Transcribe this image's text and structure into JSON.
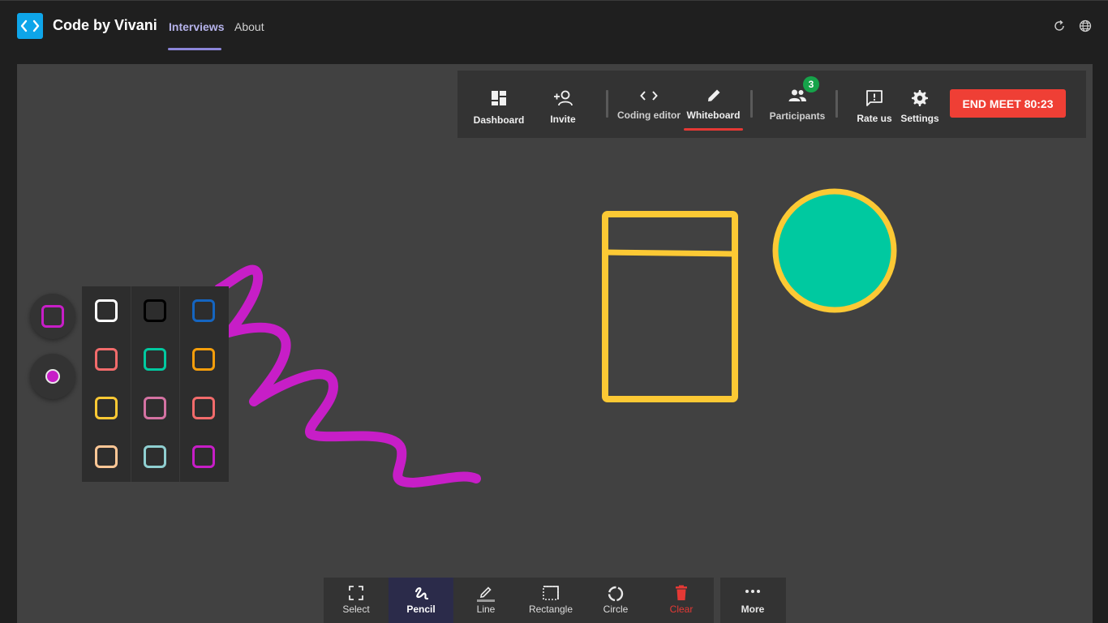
{
  "app": {
    "title": "Code by Vivani"
  },
  "nav": {
    "tabs": [
      {
        "label": "Interviews",
        "active": true
      },
      {
        "label": "About",
        "active": false
      }
    ]
  },
  "header_icons": [
    "refresh-icon",
    "globe-icon"
  ],
  "meeting_toolbar": {
    "items": [
      {
        "label": "Dashboard",
        "icon": "dashboard-icon"
      },
      {
        "label": "Invite",
        "icon": "add-person-icon"
      },
      {
        "label": "Coding editor",
        "icon": "code-icon"
      },
      {
        "label": "Whiteboard",
        "icon": "pencil-icon",
        "active": true
      },
      {
        "label": "Participants",
        "icon": "people-icon",
        "badge": "3"
      },
      {
        "label": "Rate us",
        "icon": "feedback-icon"
      },
      {
        "label": "Settings",
        "icon": "gear-icon"
      }
    ],
    "end_meet": "END MEET 80:23"
  },
  "color_palette": {
    "selected": "#c71ec7",
    "colors": [
      "#ffffff",
      "#000000",
      "#1565c0",
      "#f26b6b",
      "#00c9a0",
      "#f59e0b",
      "#fcc934",
      "#d472a2",
      "#f26b6b",
      "#ffc796",
      "#8fcfd1",
      "#c71ec7"
    ]
  },
  "drawing_tools": [
    {
      "label": "Select",
      "icon": "select-icon"
    },
    {
      "label": "Pencil",
      "icon": "scribble-icon",
      "active": true
    },
    {
      "label": "Line",
      "icon": "line-pencil-icon"
    },
    {
      "label": "Rectangle",
      "icon": "rectangle-icon"
    },
    {
      "label": "Circle",
      "icon": "circle-icon"
    },
    {
      "label": "Clear",
      "icon": "trash-icon",
      "color": "#e53935"
    }
  ],
  "more_tool": {
    "label": "More",
    "icon": "more-dots-icon"
  },
  "colors": {
    "accent": "#8b86d9",
    "end_button": "#ef3f35",
    "shape_stroke": "#fcc934",
    "circle_fill": "#00c9a0",
    "scribble": "#c71ec7"
  }
}
